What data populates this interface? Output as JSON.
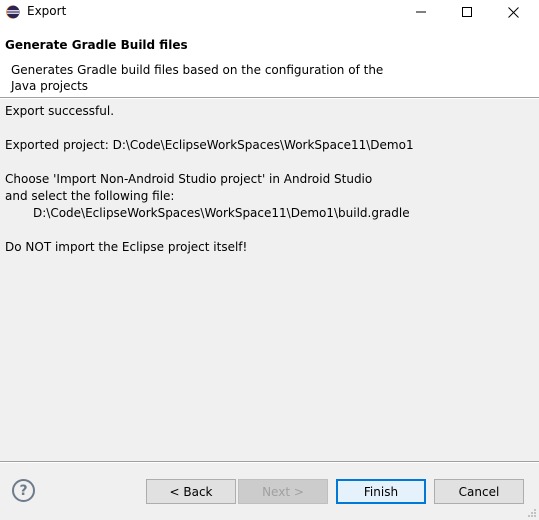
{
  "window": {
    "title": "Export"
  },
  "banner": {
    "title": "Generate Gradle Build files",
    "description": "Generates Gradle build files based on the configuration of the Java projects"
  },
  "content": {
    "line1": "Export successful.",
    "line2": "Exported project: D:\\Code\\EclipseWorkSpaces\\WorkSpace11\\Demo1",
    "line3": "Choose 'Import Non-Android Studio project' in Android Studio",
    "line4": "and select the following file:",
    "line5": "D:\\Code\\EclipseWorkSpaces\\WorkSpace11\\Demo1\\build.gradle",
    "line6": "Do NOT import the Eclipse project itself!"
  },
  "buttons": {
    "help": "?",
    "back": "< Back",
    "next": "Next >",
    "finish": "Finish",
    "cancel": "Cancel"
  },
  "icons": {
    "app": "eclipse-icon",
    "minimize": "minimize-icon",
    "maximize": "maximize-icon",
    "close": "close-icon",
    "help": "help-icon"
  },
  "colors": {
    "accent": "#0078d7",
    "window_bg": "#f0f0f0",
    "banner_bg": "#ffffff"
  }
}
